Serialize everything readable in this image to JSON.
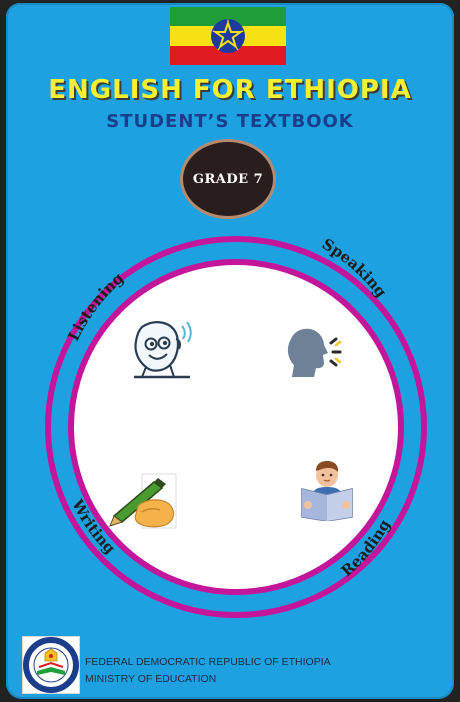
{
  "cover": {
    "title": "ENGLISH FOR ETHIOPIA",
    "subtitle": "STUDENT’S TEXTBOOK",
    "grade": "GRADE 7"
  },
  "skills": [
    {
      "label": "Listening",
      "icon": "listening-face-icon"
    },
    {
      "label": "Speaking",
      "icon": "speaking-head-icon"
    },
    {
      "label": "Writing",
      "icon": "writing-hand-icon"
    },
    {
      "label": "Reading",
      "icon": "reading-person-icon"
    }
  ],
  "footer": {
    "line1": "FEDERAL DEMOCRATIC REPUBLIC OF ETHIOPIA",
    "line2": "MINISTRY OF EDUCATION",
    "logo_text": "MINISTRY OF EDUCATION"
  },
  "colors": {
    "background": "#1da1e0",
    "title": "#f4ef30",
    "subtitle": "#1b3e8c",
    "ring": "#c4169a",
    "flag_green": "#1f9e3a",
    "flag_yellow": "#f6e214",
    "flag_red": "#e11b22",
    "emblem": "#1e3a9e"
  }
}
